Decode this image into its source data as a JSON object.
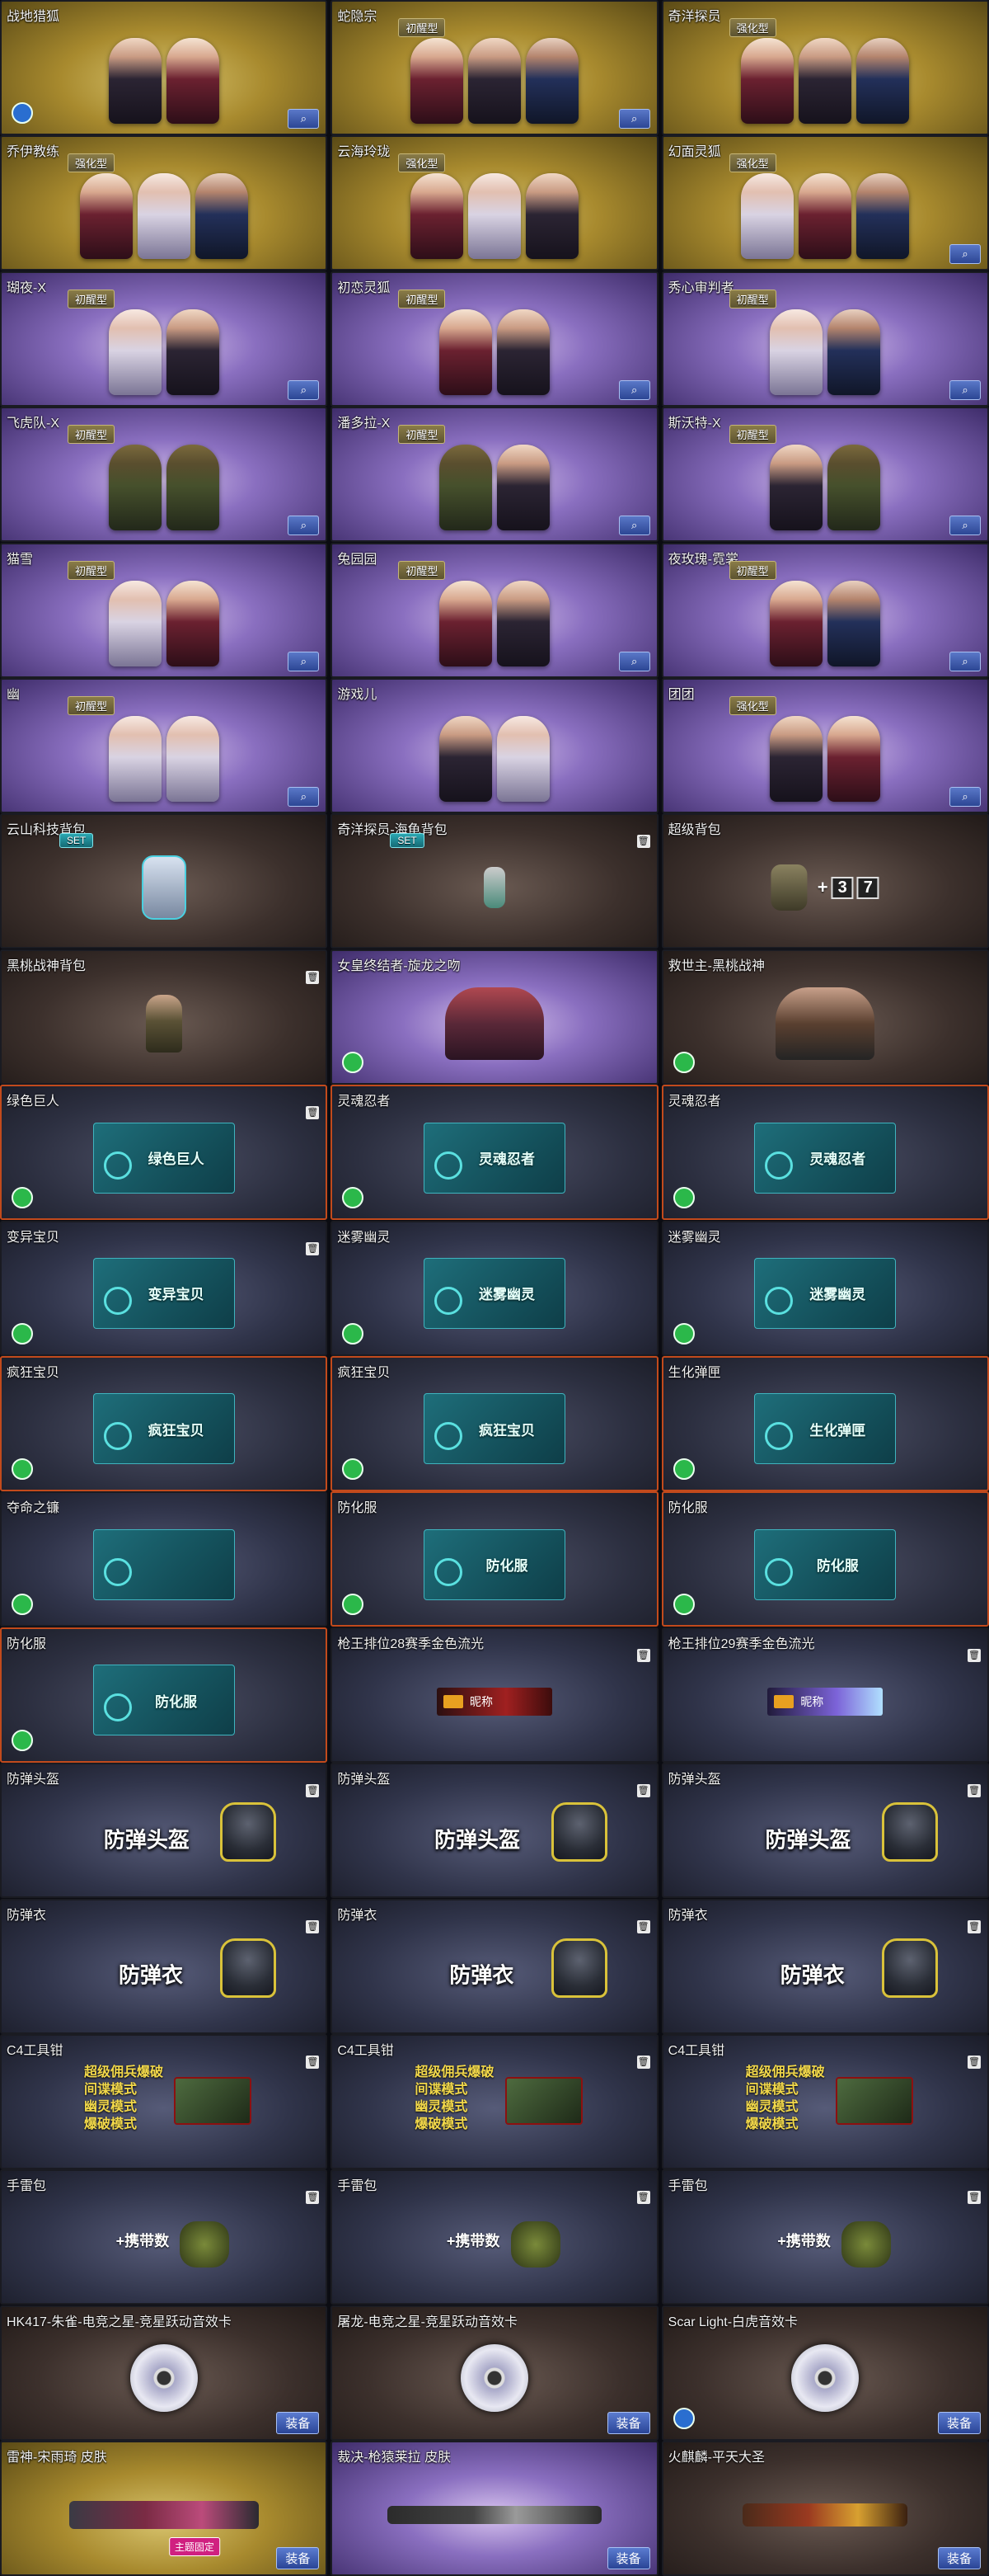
{
  "ui": {
    "equip_label": "装备",
    "search_glyph": "⌕",
    "trash_glyph": "🗑",
    "badge_icon_names": [
      "trash-icon",
      "search-icon",
      "magnify-icon",
      "lock-icon"
    ]
  },
  "cards": [
    {
      "id": "c1",
      "title": "战地猎狐",
      "bg": "gold",
      "kind": "figs",
      "figs": [
        "c1",
        "c2"
      ],
      "button": "search",
      "lock": "blue"
    },
    {
      "id": "c2",
      "title": "蛇隐宗",
      "bg": "gold",
      "badge": "初醒型",
      "kind": "figs",
      "figs": [
        "c2",
        "c1",
        "c3"
      ],
      "button": "magnify"
    },
    {
      "id": "c3",
      "title": "奇洋探员",
      "bg": "gold",
      "badge": "强化型",
      "kind": "figs",
      "figs": [
        "c2",
        "c1",
        "c3"
      ]
    },
    {
      "id": "c4",
      "title": "乔伊教练",
      "bg": "gold",
      "badge": "强化型",
      "kind": "figs",
      "figs": [
        "c2",
        "c5",
        "c3"
      ]
    },
    {
      "id": "c5",
      "title": "云海玲珑",
      "bg": "gold",
      "badge": "强化型",
      "kind": "figs",
      "figs": [
        "c2",
        "c5",
        "c1"
      ]
    },
    {
      "id": "c6",
      "title": "幻面灵狐",
      "bg": "gold",
      "badge": "强化型",
      "kind": "figs",
      "figs": [
        "c5",
        "c2",
        "c3"
      ],
      "button": "magnify"
    },
    {
      "id": "c7",
      "title": "瑚夜-X",
      "bg": "purple",
      "badge": "初醒型",
      "kind": "figs",
      "figs": [
        "c5",
        "c1"
      ],
      "button": "magnify"
    },
    {
      "id": "c8",
      "title": "初恋灵狐",
      "bg": "purple",
      "badge": "初醒型",
      "kind": "figs",
      "figs": [
        "c2",
        "c1"
      ],
      "button": "magnify"
    },
    {
      "id": "c9",
      "title": "秀心审判者",
      "bg": "purple",
      "badge": "初醒型",
      "kind": "figs",
      "figs": [
        "c5",
        "c3"
      ],
      "button": "magnify"
    },
    {
      "id": "c10",
      "title": "飞虎队-X",
      "bg": "purple",
      "badge": "初醒型",
      "kind": "figs",
      "figs": [
        "c4",
        "c4"
      ],
      "button": "magnify"
    },
    {
      "id": "c11",
      "title": "潘多拉-X",
      "bg": "purple",
      "badge": "初醒型",
      "kind": "figs",
      "figs": [
        "c4",
        "c1"
      ],
      "button": "magnify"
    },
    {
      "id": "c12",
      "title": "斯沃特-X",
      "bg": "purple",
      "badge": "初醒型",
      "kind": "figs",
      "figs": [
        "c1",
        "c4"
      ],
      "button": "magnify"
    },
    {
      "id": "c13",
      "title": "猫雪",
      "bg": "purple",
      "badge": "初醒型",
      "kind": "figs",
      "figs": [
        "c5",
        "c2"
      ],
      "button": "magnify"
    },
    {
      "id": "c14",
      "title": "兔园园",
      "bg": "purple",
      "badge": "初醒型",
      "kind": "figs",
      "figs": [
        "c2",
        "c1"
      ],
      "button": "magnify"
    },
    {
      "id": "c15",
      "title": "夜玫瑰-霓裳",
      "bg": "purple",
      "badge": "初醒型",
      "kind": "figs",
      "figs": [
        "c2",
        "c3"
      ],
      "button": "magnify"
    },
    {
      "id": "c16",
      "title": "幽",
      "bg": "purple",
      "badge": "初醒型",
      "kind": "figs",
      "figs": [
        "c5",
        "c5"
      ],
      "button": "magnify"
    },
    {
      "id": "c17",
      "title": "游戏儿",
      "bg": "purple",
      "kind": "figs",
      "figs": [
        "c1",
        "c5"
      ]
    },
    {
      "id": "c18",
      "title": "团团",
      "bg": "purple",
      "badge": "强化型",
      "kind": "figs",
      "figs": [
        "c1",
        "c2"
      ],
      "button": "magnify"
    },
    {
      "id": "c19",
      "title": "云山科技背包",
      "bg": "brown",
      "set": "SET",
      "kind": "bag1"
    },
    {
      "id": "c20",
      "title": "奇洋探员-海龟背包",
      "bg": "brown",
      "set": "SET",
      "kind": "bag2",
      "trash": true
    },
    {
      "id": "c21",
      "title": "超级背包",
      "bg": "brown",
      "kind": "bag3",
      "boost_a": "+",
      "num1": "3",
      "num2": "7"
    },
    {
      "id": "c22",
      "title": "黑桃战神背包",
      "bg": "brown",
      "kind": "char",
      "trash": true
    },
    {
      "id": "c23",
      "title": "女皇终结者-旋龙之吻",
      "bg": "purple",
      "kind": "bust",
      "lock": "green"
    },
    {
      "id": "c24",
      "title": "救世主-黑桃战神",
      "bg": "brown",
      "kind": "bust2",
      "lock": "green"
    },
    {
      "id": "c25",
      "title": "绿色巨人",
      "bg": "orange",
      "kind": "ribbon",
      "ribbon": "绿色巨人",
      "lock": "green",
      "trash": true
    },
    {
      "id": "c26",
      "title": "灵魂忍者",
      "bg": "orange",
      "kind": "ribbon",
      "ribbon": "灵魂忍者",
      "lock": "green"
    },
    {
      "id": "c27",
      "title": "灵魂忍者",
      "bg": "orange",
      "kind": "ribbon",
      "ribbon": "灵魂忍者",
      "lock": "green"
    },
    {
      "id": "c28",
      "title": "变异宝贝",
      "bg": "navy",
      "kind": "ribbon",
      "ribbon": "变异宝贝",
      "lock": "green",
      "trash": true
    },
    {
      "id": "c29",
      "title": "迷雾幽灵",
      "bg": "navy",
      "kind": "ribbon",
      "ribbon": "迷雾幽灵",
      "lock": "green"
    },
    {
      "id": "c30",
      "title": "迷雾幽灵",
      "bg": "navy",
      "kind": "ribbon",
      "ribbon": "迷雾幽灵",
      "lock": "green"
    },
    {
      "id": "c31",
      "title": "疯狂宝贝",
      "bg": "orange",
      "kind": "ribbon",
      "ribbon": "疯狂宝贝",
      "lock": "green"
    },
    {
      "id": "c32",
      "title": "疯狂宝贝",
      "bg": "orange",
      "kind": "ribbon",
      "ribbon": "疯狂宝贝",
      "lock": "green"
    },
    {
      "id": "c33",
      "title": "生化弹匣",
      "bg": "orange",
      "kind": "ribbon",
      "ribbon": "生化弹匣",
      "lock": "green"
    },
    {
      "id": "c34",
      "title": "夺命之镰",
      "bg": "navy",
      "kind": "ribbon",
      "ribbon": "",
      "lock": "green"
    },
    {
      "id": "c35",
      "title": "防化服",
      "bg": "orange",
      "kind": "ribbon",
      "ribbon": "防化服",
      "lock": "green"
    },
    {
      "id": "c36",
      "title": "防化服",
      "bg": "orange",
      "kind": "ribbon",
      "ribbon": "防化服",
      "lock": "green"
    },
    {
      "id": "c37",
      "title": "防化服",
      "bg": "orange",
      "kind": "ribbon",
      "ribbon": "防化服",
      "lock": "green"
    },
    {
      "id": "c38",
      "title": "枪王排位28赛季金色流光",
      "bg": "navy",
      "kind": "tag",
      "tag_style": "red",
      "tag": "昵称",
      "trash": true
    },
    {
      "id": "c39",
      "title": "枪王排位29赛季金色流光",
      "bg": "navy",
      "kind": "tag",
      "tag_style": "violet",
      "tag": "昵称",
      "trash": true
    },
    {
      "id": "c40",
      "title": "防弹头盔",
      "bg": "navy",
      "kind": "big",
      "big": "防弹头盔",
      "trash": true
    },
    {
      "id": "c41",
      "title": "防弹头盔",
      "bg": "navy",
      "kind": "big",
      "big": "防弹头盔",
      "trash": true
    },
    {
      "id": "c42",
      "title": "防弹头盔",
      "bg": "navy",
      "kind": "big",
      "big": "防弹头盔",
      "trash": true
    },
    {
      "id": "c43",
      "title": "防弹衣",
      "bg": "navy",
      "kind": "big",
      "big": "防弹衣",
      "trash": true
    },
    {
      "id": "c44",
      "title": "防弹衣",
      "bg": "navy",
      "kind": "big",
      "big": "防弹衣",
      "trash": true
    },
    {
      "id": "c45",
      "title": "防弹衣",
      "bg": "navy",
      "kind": "big",
      "big": "防弹衣",
      "trash": true
    },
    {
      "id": "c46",
      "title": "C4工具钳",
      "bg": "navy",
      "kind": "c4",
      "trash": true
    },
    {
      "id": "c47",
      "title": "C4工具钳",
      "bg": "navy",
      "kind": "c4",
      "trash": true
    },
    {
      "id": "c48",
      "title": "C4工具钳",
      "bg": "navy",
      "kind": "c4",
      "trash": true
    },
    {
      "id": "c49",
      "title": "手雷包",
      "bg": "navy",
      "kind": "grenade",
      "trash": true
    },
    {
      "id": "c50",
      "title": "手雷包",
      "bg": "navy",
      "kind": "grenade",
      "trash": true
    },
    {
      "id": "c51",
      "title": "手雷包",
      "bg": "navy",
      "kind": "grenade",
      "trash": true
    },
    {
      "id": "c52",
      "title": "HK417-朱雀-电竞之星-竞星跃动音效卡",
      "bg": "brown",
      "kind": "disc",
      "equip": true
    },
    {
      "id": "c53",
      "title": "屠龙-电竞之星-竞星跃动音效卡",
      "bg": "brown",
      "kind": "disc",
      "equip": true
    },
    {
      "id": "c54",
      "title": "Scar Light-白虎音效卡",
      "bg": "brown",
      "kind": "disc",
      "equip": true,
      "lock": "blue"
    },
    {
      "id": "c55",
      "title": "雷神-宋雨琦 皮肤",
      "bg": "gold",
      "kind": "gun",
      "gun": "w1",
      "fixed": "主题固定",
      "equip": true
    },
    {
      "id": "c56",
      "title": "裁决-枪猿莱拉 皮肤",
      "bg": "purple",
      "kind": "gun",
      "gun": "w2",
      "equip": true
    },
    {
      "id": "c57",
      "title": "火麒麟-平天大圣",
      "bg": "brown",
      "kind": "gun",
      "gun": "w3",
      "equip": true
    }
  ],
  "c4_lines": [
    "超级佣兵爆破",
    "间谍模式",
    "幽灵模式",
    "爆破模式"
  ],
  "grenade_text": "+携带数"
}
